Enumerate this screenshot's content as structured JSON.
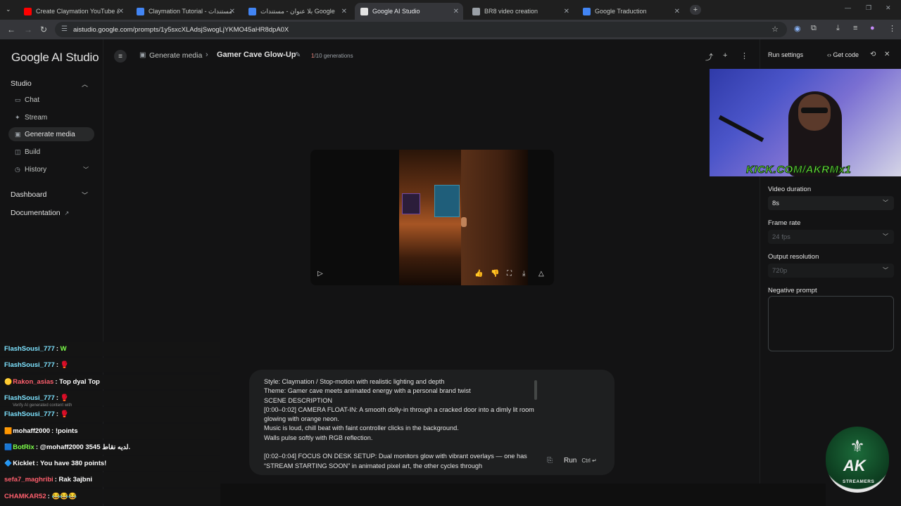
{
  "browser": {
    "tabs": [
      {
        "label": "Create Claymation YouTube &",
        "icon": "youtube-icon",
        "icon_color": "#ff0000"
      },
      {
        "label": "Claymation Tutorial - مستندات",
        "icon": "docs-icon",
        "icon_color": "#4285f4"
      },
      {
        "label": "بلا عنوان - مستندات Google",
        "icon": "docs-icon",
        "icon_color": "#4285f4"
      },
      {
        "label": "Google AI Studio",
        "icon": "ai-studio-icon",
        "icon_color": "#e3e3e3",
        "active": true
      },
      {
        "label": "BR8 video creation",
        "icon": "globe-icon",
        "icon_color": "#9aa0a6"
      },
      {
        "label": "Google Traduction",
        "icon": "translate-icon",
        "icon_color": "#4285f4"
      }
    ],
    "url": "aistudio.google.com/prompts/1y5sxcXLAdsjSwogLjYKMO45aHR8dpA0X"
  },
  "sidebar": {
    "brand": "Google AI Studio",
    "studio_label": "Studio",
    "items": [
      {
        "label": "Chat",
        "icon": "chat-icon"
      },
      {
        "label": "Stream",
        "icon": "stream-icon"
      },
      {
        "label": "Generate media",
        "icon": "media-icon",
        "active": true
      },
      {
        "label": "Build",
        "icon": "build-icon"
      },
      {
        "label": "History",
        "icon": "history-icon"
      }
    ],
    "dashboard_label": "Dashboard",
    "documentation_label": "Documentation"
  },
  "header": {
    "breadcrumb_parent": "Generate media",
    "title": "Gamer Cave Glow-Up",
    "generations_current": "1",
    "generations_rest": "/10 generations"
  },
  "prompt": {
    "text": "Style: Claymation / Stop-motion with realistic lighting and depth\nTheme: Gamer cave meets animated energy with a personal brand twist\nSCENE DESCRIPTION\n[0:00–0:02] CAMERA FLOAT-IN: A smooth dolly-in through a cracked door into a dimly lit room glowing with orange neon.\nMusic is loud, chill beat with faint controller clicks in the background.\nWalls pulse softly with RGB reflection.\n\n[0:02–0:04] FOCUS ON DESK SETUP: Dual monitors glow with vibrant overlays — one has “STREAM STARTING SOON” in animated pixel art, the other cycles through",
    "run_label": "Run",
    "run_shortcut": "Ctrl ↵"
  },
  "settings": {
    "title": "Run settings",
    "get_code_label": "Get code",
    "video_duration_label": "Video duration",
    "video_duration_value": "8s",
    "frame_rate_label": "Frame rate",
    "frame_rate_value": "24 fps",
    "output_resolution_label": "Output resolution",
    "output_resolution_value": "720p",
    "negative_prompt_label": "Negative prompt"
  },
  "stream_overlay": {
    "cam_label": "KICK.COM/AKRMx1",
    "ghost_text": "Verify AI generated content with",
    "chat": [
      {
        "user": "FlashSousi_777",
        "color": "#7ee3ff",
        "badge": "",
        "msg": " W",
        "msg_color": "#7dff4a"
      },
      {
        "user": "FlashSousi_777",
        "color": "#7ee3ff",
        "badge": "",
        "msg": " 🥊",
        "msg_color": "#ffffff"
      },
      {
        "user": "Rakon_asias",
        "color": "#ff5f6d",
        "badge": "🟡",
        "msg": " Top dyal Top",
        "msg_color": "#ffffff"
      },
      {
        "user": "FlashSousi_777",
        "color": "#7ee3ff",
        "badge": "",
        "msg": " 🥊",
        "msg_color": "#ffffff"
      },
      {
        "user": "FlashSousi_777",
        "color": "#7ee3ff",
        "badge": "",
        "msg": " 🥊",
        "msg_color": "#ffffff"
      },
      {
        "user": "mohaff2000",
        "color": "#ffffff",
        "badge": "🟧",
        "msg": " !points",
        "msg_color": "#ffffff"
      },
      {
        "user": "BotRix",
        "color": "#7dff4a",
        "badge": "🟦",
        "msg": " @mohaff2000 3545 لديه نقاط.",
        "msg_color": "#ffffff"
      },
      {
        "user": "Kicklet",
        "color": "#ffffff",
        "badge": "🔷",
        "msg": " You have 380 points!",
        "msg_color": "#ffffff"
      },
      {
        "user": "sefa7_maghribi",
        "color": "#ff5f6d",
        "badge": "",
        "msg": " Rak 3ajbni",
        "msg_color": "#ffffff"
      },
      {
        "user": "CHAMKAR52",
        "color": "#ff5f6d",
        "badge": "",
        "msg": " 😂😂😂",
        "msg_color": "#ffffff"
      }
    ],
    "logo_main": "AK",
    "logo_sub": "STREAMERS"
  }
}
